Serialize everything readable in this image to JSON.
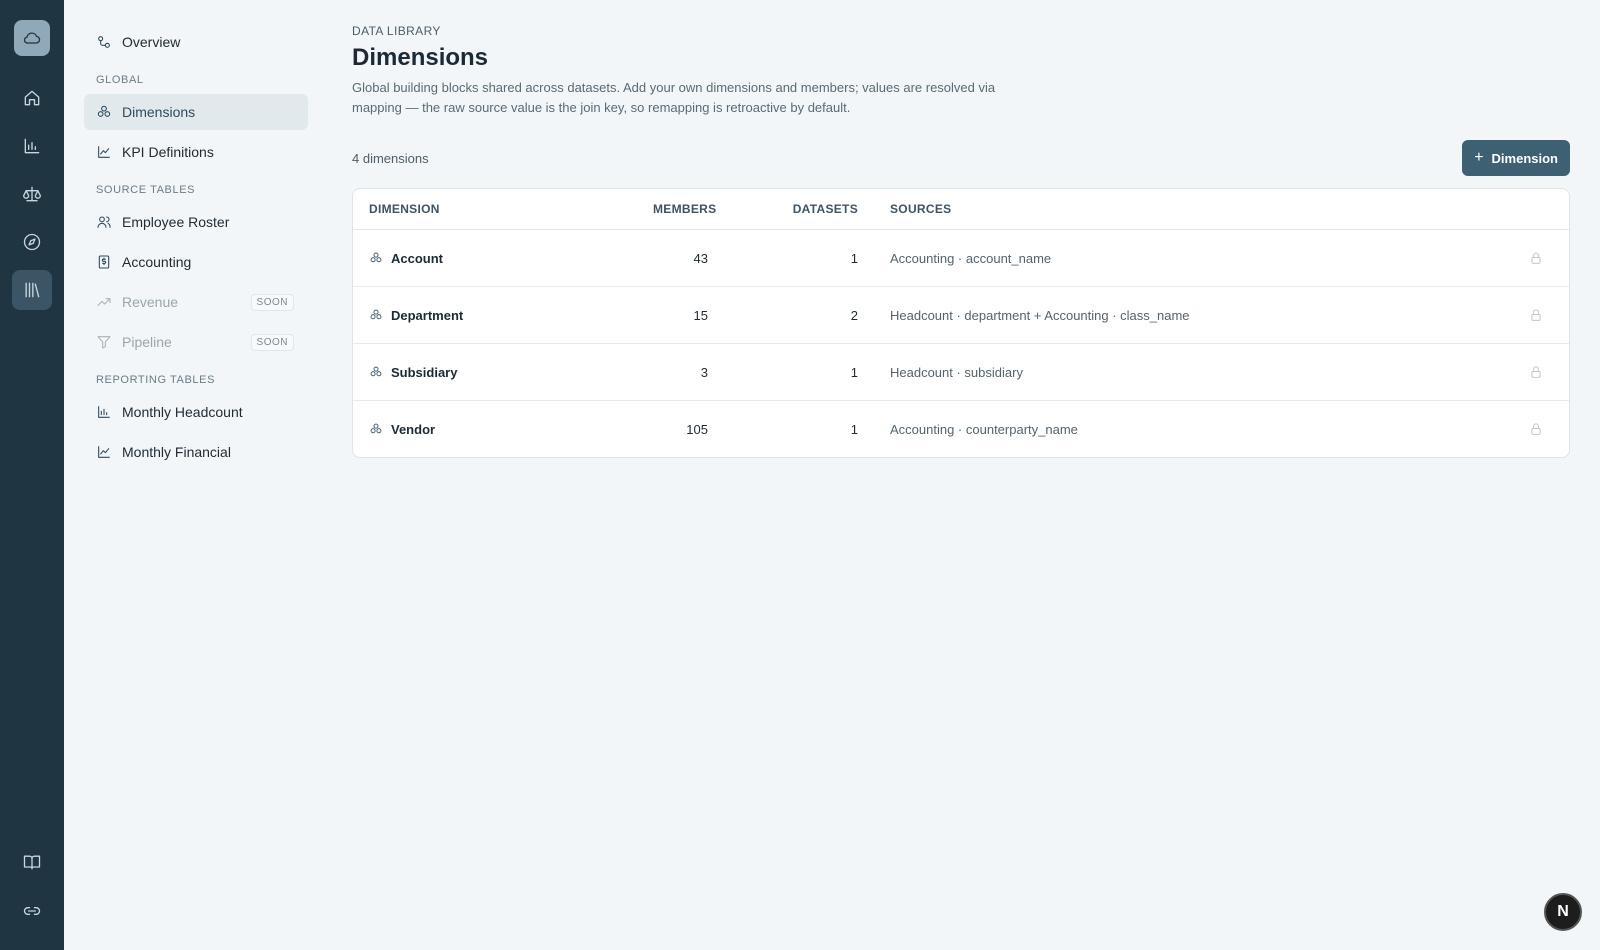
{
  "rail": {
    "logo_icon": "cloud-icon",
    "items": [
      {
        "icon": "home-icon",
        "active": false
      },
      {
        "icon": "bar-chart-icon",
        "active": false
      },
      {
        "icon": "scale-icon",
        "active": false
      },
      {
        "icon": "compass-icon",
        "active": false
      },
      {
        "icon": "library-icon",
        "active": true
      }
    ],
    "bottom": [
      {
        "icon": "book-icon"
      },
      {
        "icon": "link-icon"
      }
    ]
  },
  "nav": {
    "overview": "Overview",
    "global_title": "GLOBAL",
    "global_items": [
      {
        "label": "Dimensions",
        "icon": "dimensions-icon",
        "active": true
      },
      {
        "label": "KPI Definitions",
        "icon": "line-chart-icon",
        "active": false
      }
    ],
    "source_title": "SOURCE TABLES",
    "source_items": [
      {
        "label": "Employee Roster",
        "icon": "users-icon"
      },
      {
        "label": "Accounting",
        "icon": "dollar-doc-icon"
      },
      {
        "label": "Revenue",
        "icon": "trend-icon",
        "badge": "SOON"
      },
      {
        "label": "Pipeline",
        "icon": "filter-icon",
        "badge": "SOON"
      }
    ],
    "reporting_title": "REPORTING TABLES",
    "reporting_items": [
      {
        "label": "Monthly Headcount",
        "icon": "bar-chart-icon"
      },
      {
        "label": "Monthly Financial",
        "icon": "line-chart-icon"
      }
    ]
  },
  "header": {
    "eyebrow": "DATA LIBRARY",
    "title": "Dimensions",
    "description": "Global building blocks shared across datasets. Add your own dimensions and members; values are resolved via mapping — the raw source value is the join key, so remapping is retroactive by default."
  },
  "toolbar": {
    "count": "4 dimensions",
    "add_label": "Dimension"
  },
  "table": {
    "columns": [
      "DIMENSION",
      "MEMBERS",
      "DATASETS",
      "SOURCES"
    ],
    "rows": [
      {
        "name": "Account",
        "members": "43",
        "datasets": "1",
        "sources": "Accounting · account_name"
      },
      {
        "name": "Department",
        "members": "15",
        "datasets": "2",
        "sources": "Headcount · department + Accounting · class_name"
      },
      {
        "name": "Subsidiary",
        "members": "3",
        "datasets": "1",
        "sources": "Headcount · subsidiary"
      },
      {
        "name": "Vendor",
        "members": "105",
        "datasets": "1",
        "sources": "Accounting · counterparty_name"
      }
    ]
  },
  "avatar": {
    "initial": "N"
  }
}
